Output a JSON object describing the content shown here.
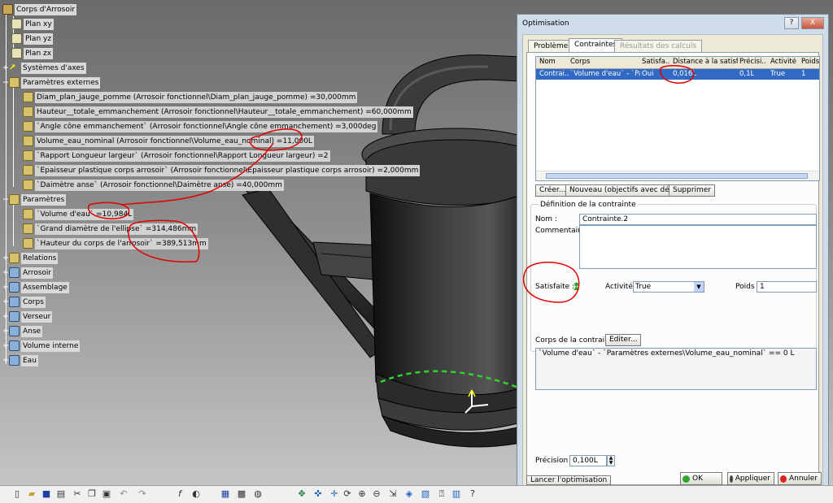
{
  "tree": {
    "root": "Corps d'Arrosoir",
    "items": [
      {
        "label": "Plan xy"
      },
      {
        "label": "Plan yz"
      },
      {
        "label": "Plan zx"
      },
      {
        "label": "Systèmes d'axes"
      },
      {
        "label": "Paramètres externes"
      },
      {
        "label": "Diam_plan_jauge_pomme (Arrosoir fonctionnel\\Diam_plan_jauge_pomme) =30,000mm"
      },
      {
        "label": "Hauteur__totale_emmanchement (Arrosoir fonctionnel\\Hauteur__totale_emmanchement) =60,000mm"
      },
      {
        "label": "`Angle cône emmanchement` (Arrosoir fonctionnel\\Angle cône emmanchement) =3,000deg"
      },
      {
        "label": "Volume_eau_nominal (Arrosoir fonctionnel\\Volume_eau_nominal) =11,000L"
      },
      {
        "label": "`Rapport Longueur largeur` (Arrosoir fonctionnel\\Rapport Longueur largeur) =2"
      },
      {
        "label": "`Epaisseur plastique corps arrosoir` (Arrosoir fonctionnel\\Epaisseur plastique corps arrosoir) =2,000mm"
      },
      {
        "label": "`Daimètre anse` (Arrosoir fonctionnel\\Daimètre anse) =40,000mm"
      },
      {
        "label": "Paramètres"
      },
      {
        "label": "`Volume d'eau` =10,984L"
      },
      {
        "label": "`Grand diamètre de l'ellipse` =314,486mm"
      },
      {
        "label": "`Hauteur du corps de l'arrosoir` =389,513mm"
      },
      {
        "label": "Relations"
      },
      {
        "label": "Arrosoir"
      },
      {
        "label": "Assemblage"
      },
      {
        "label": "Corps"
      },
      {
        "label": "Verseur"
      },
      {
        "label": "Anse"
      },
      {
        "label": "Volume interne"
      },
      {
        "label": "Eau"
      }
    ]
  },
  "dialog": {
    "title": "Optimisation",
    "help": "?",
    "close": "X",
    "tabs": [
      "Problème",
      "Contraintes",
      "Résultats des calculs"
    ],
    "columns": [
      "Nom",
      "Corps",
      "Satisfa...",
      "Distance à la satisf...",
      "Précisi...",
      "Activité",
      "Poids"
    ],
    "row": [
      "Contrai...",
      "`Volume d'eau` - `Pa...",
      "Oui",
      "0,016L",
      "0,1L",
      "True",
      "1"
    ],
    "buttons": {
      "create": "Créer...",
      "new": "Nouveau (objectifs avec dérivées)",
      "delete": "Supprimer"
    },
    "definition_label": "Définition de la contrainte",
    "name_label": "Nom :",
    "name_value": "Contrainte.2",
    "comment_label": "Commentaire :",
    "satisfied_label": "Satisfaite :",
    "activity_label": "Activité :",
    "activity_value": "True",
    "weight_label": "Poids :",
    "weight_value": "1",
    "body_label": "Corps de la contrainte :",
    "edit_button": "Editer...",
    "body_text": "`Volume d'eau` - `Paramètres externes\\Volume_eau_nominal` == 0 L",
    "precision_label": "Précision :",
    "precision_value": "0,100L",
    "run_button": "Lancer l'optimisation",
    "ok": "OK",
    "apply": "Appliquer",
    "cancel": "Annuler"
  },
  "colors": {
    "selection": "#316ac5",
    "annotation": "#e00000",
    "background_top": "#6b6b6b",
    "background_bottom": "#c8c8c8",
    "dialog": "#ece9d8"
  },
  "toolbar_icons": [
    "new-icon",
    "open-icon",
    "save-icon",
    "print-icon",
    "cut-icon",
    "copy-icon",
    "paste-icon",
    "undo-icon",
    "redo-icon",
    "formula-icon",
    "knowledge-icon",
    "table-icon",
    "fit-all-icon",
    "pan-icon",
    "rotate-icon",
    "zoom-in-icon",
    "zoom-out-icon",
    "normal-view-icon",
    "iso-view-icon",
    "render-icon",
    "hide-show-icon",
    "swap-icon"
  ]
}
